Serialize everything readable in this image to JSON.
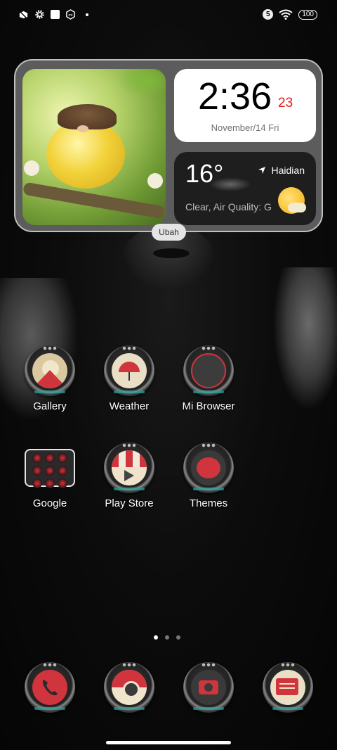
{
  "status_bar": {
    "left_icons": [
      "app-notification-icon",
      "gear-icon",
      "square-icon",
      "mi-icon",
      "dot-icon"
    ],
    "sim_label": "5",
    "battery": "100"
  },
  "widget": {
    "clock_time": "2:36",
    "clock_seconds": "23",
    "date": "November/14 Fri",
    "temperature": "16°",
    "location": "Haidian",
    "condition": "Clear, Air Quality: G",
    "edit_label": "Ubah"
  },
  "apps": {
    "row1": [
      {
        "label": "Gallery",
        "icon": "gallery-icon"
      },
      {
        "label": "Weather",
        "icon": "weather-icon"
      },
      {
        "label": "Mi Browser",
        "icon": "browser-icon"
      }
    ],
    "row2": [
      {
        "label": "Google",
        "icon": "folder-icon"
      },
      {
        "label": "Play Store",
        "icon": "play-store-icon"
      },
      {
        "label": "Themes",
        "icon": "themes-icon"
      }
    ]
  },
  "pager": {
    "pages": 3,
    "current": 1
  },
  "dock": [
    "phone-icon",
    "chrome-icon",
    "camera-icon",
    "messages-icon"
  ],
  "colors": {
    "accent_red": "#d0343c",
    "date_red": "#e02020",
    "teal": "#2aa7a0"
  }
}
